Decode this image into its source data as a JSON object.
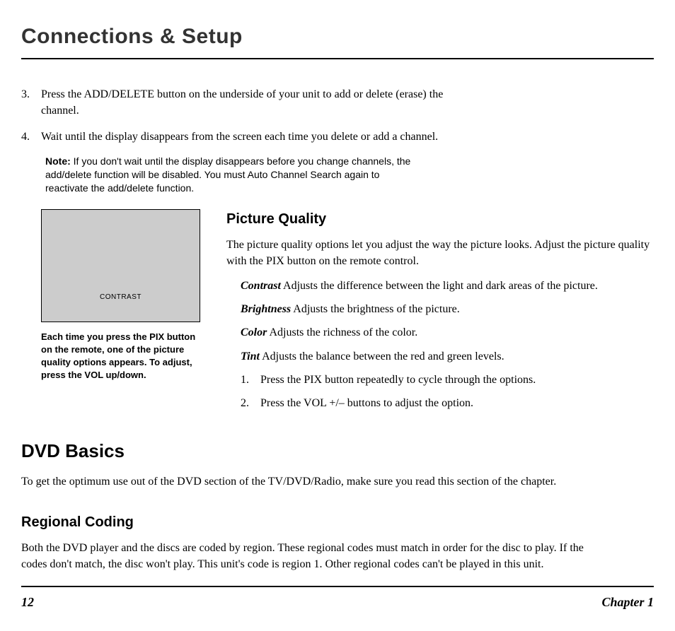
{
  "title": "Connections & Setup",
  "steps": [
    {
      "n": "3.",
      "text": "Press the ADD/DELETE button on the underside of your unit to add or delete (erase) the channel."
    },
    {
      "n": "4.",
      "text": "Wait until the display disappears from the screen each time you delete or add a channel."
    }
  ],
  "note_label": "Note:",
  "note_body": " If you don't wait until the display disappears before you change channels, the add/delete function will be disabled. You must Auto Channel Search again to reactivate the add/delete function.",
  "screen_label": "CONTRAST",
  "screen_caption": "Each time you press the PIX button on the remote, one of the picture quality options appears. To adjust, press the VOL up/down.",
  "picture_quality": {
    "heading": "Picture Quality",
    "intro": "The picture quality options let you adjust the way the picture looks. Adjust the picture quality with the PIX button on the remote control.",
    "defs": [
      {
        "term": "Contrast",
        "desc": "   Adjusts the difference between the light and dark areas of the picture."
      },
      {
        "term": "Brightness",
        "desc": "   Adjusts the brightness of the picture."
      },
      {
        "term": "Color",
        "desc": "   Adjusts the richness of the color."
      },
      {
        "term": "Tint",
        "desc": "   Adjusts the balance between the red and green levels."
      }
    ],
    "inner_steps": [
      {
        "n": "1.",
        "text": "Press the PIX button repeatedly to cycle through the options."
      },
      {
        "n": "2.",
        "text": "Press the VOL +/– buttons to adjust the option."
      }
    ]
  },
  "dvd_basics": {
    "heading": "DVD Basics",
    "intro": "To get the optimum use out of the DVD section of the TV/DVD/Radio, make sure you read this section of the chapter."
  },
  "regional": {
    "heading": "Regional Coding",
    "body": "Both the DVD player and the discs are coded by region. These regional codes must match in order for the disc to play. If the codes don't match, the disc won't play. This unit's code is region 1. Other regional codes can't be played in this unit."
  },
  "footer": {
    "page": "12",
    "chapter": "Chapter 1"
  }
}
